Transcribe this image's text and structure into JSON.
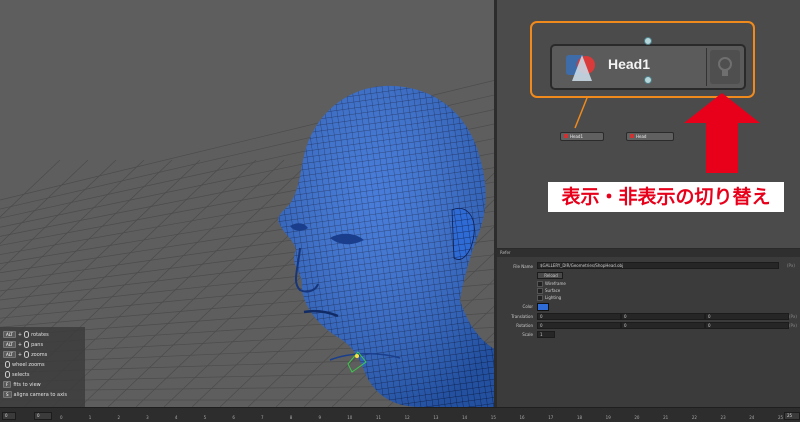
{
  "node_graph": {
    "main_node_label": "Head1",
    "mini_node_1_label": "Head1",
    "mini_node_2_label": "Head"
  },
  "annotation": {
    "caption": "表示・非表示の切り替え",
    "caption_color": "#e8001b",
    "callout_color": "#f08a1c",
    "arrow_color": "#e8001b"
  },
  "properties": {
    "header": "Refer",
    "file_name_label": "File Name",
    "file_name_value": "$GALLERY_DIR/Geometries/ShopHead.obj",
    "reload_button": "Reload",
    "checkbox_wireframe": "Wireframe",
    "checkbox_surface": "Surface",
    "checkbox_lighting": "Lighting",
    "color_label": "Color",
    "color_value": "#2f6bd4",
    "translation_label": "Translation",
    "translation_values": [
      "0",
      "0",
      "0"
    ],
    "rotation_label": "Rotation",
    "rotation_values": [
      "0",
      "0",
      "0"
    ],
    "scale_label": "Scale",
    "scale_value": "1",
    "unit_label": "(Px)"
  },
  "help": {
    "alt_key": "ALT",
    "plus": "+",
    "rotates": "rotates",
    "pans": "pans",
    "zooms": "zooms",
    "wheel_zooms": "wheel zooms",
    "selects": "selects",
    "f_key": "F",
    "fits_to_view": "fits to view",
    "s_key": "S",
    "aligns_camera": "aligns camera to axis"
  },
  "timeline": {
    "start": "0",
    "current": "0",
    "end": "25",
    "ticks": [
      "0",
      "1",
      "2",
      "3",
      "4",
      "5",
      "6",
      "7",
      "8",
      "9",
      "10",
      "11",
      "12",
      "13",
      "14",
      "15",
      "16",
      "17",
      "18",
      "19",
      "20",
      "21",
      "22",
      "23",
      "24",
      "25"
    ]
  },
  "mesh_color": "#2f6bd4",
  "viewport_bg": "#5e5e5e"
}
